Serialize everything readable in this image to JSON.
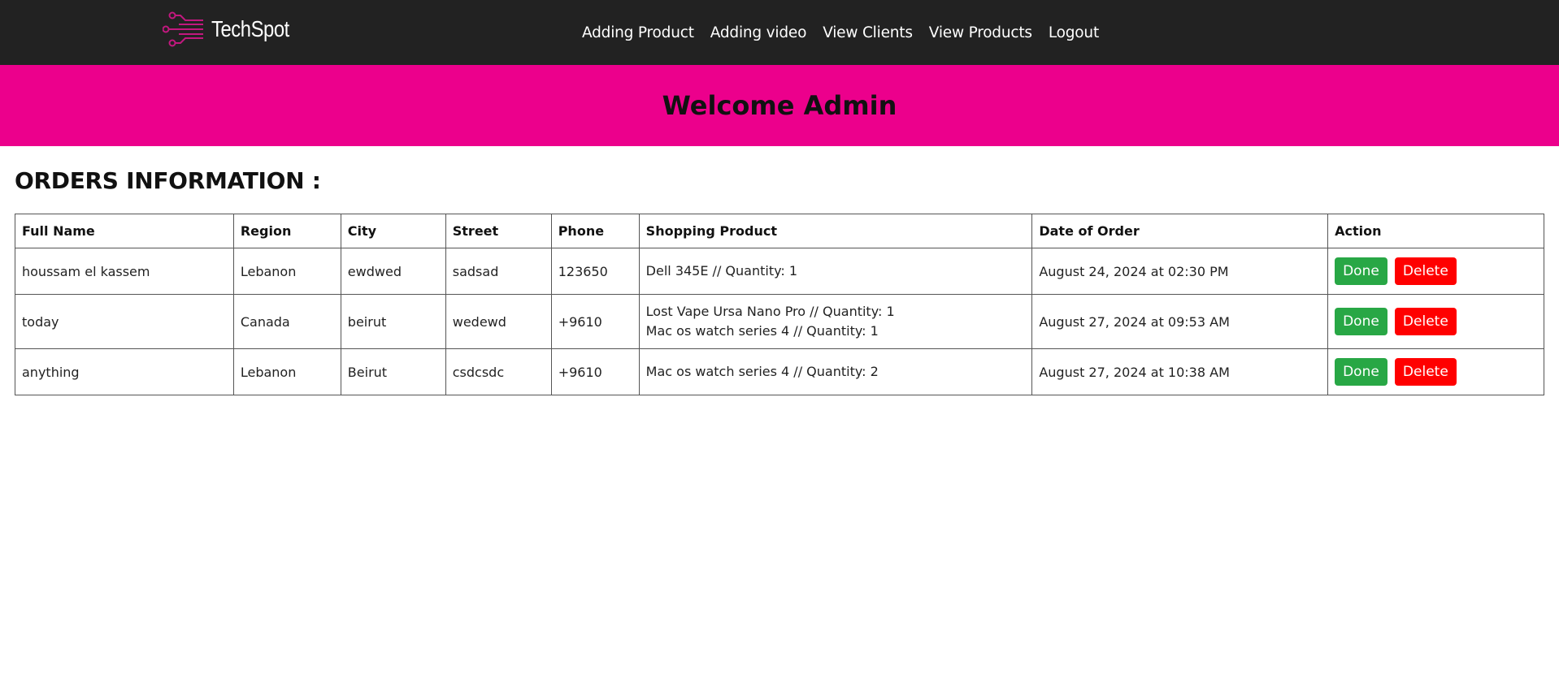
{
  "brand": {
    "name": "TechSpot",
    "logo_icon": "circuit-icon",
    "accent_color": "#ec008c"
  },
  "nav": {
    "items": [
      {
        "label": "Adding Product"
      },
      {
        "label": "Adding video"
      },
      {
        "label": "View Clients"
      },
      {
        "label": "View Products"
      },
      {
        "label": "Logout"
      }
    ]
  },
  "banner": {
    "title": "Welcome Admin",
    "background": "#ec008c"
  },
  "orders": {
    "title": "ORDERS INFORMATION :",
    "columns": [
      "Full Name",
      "Region",
      "City",
      "Street",
      "Phone",
      "Shopping Product",
      "Date of Order",
      "Action"
    ],
    "rows": [
      {
        "full_name": "houssam el kassem",
        "region": "Lebanon",
        "city": "ewdwed",
        "street": "sadsad",
        "phone": "123650",
        "products": [
          "Dell 345E // Quantity: 1"
        ],
        "date": "August 24, 2024 at 02:30 PM"
      },
      {
        "full_name": "today",
        "region": "Canada",
        "city": "beirut",
        "street": "wedewd",
        "phone": "+9610",
        "products": [
          "Lost Vape Ursa Nano Pro // Quantity: 1",
          "Mac os watch series 4 // Quantity: 1"
        ],
        "date": "August 27, 2024 at 09:53 AM"
      },
      {
        "full_name": "anything",
        "region": "Lebanon",
        "city": "Beirut",
        "street": "csdcsdc",
        "phone": "+9610",
        "products": [
          "Mac os watch series 4 // Quantity: 2"
        ],
        "date": "August 27, 2024 at 10:38 AM"
      }
    ],
    "actions": {
      "done_label": "Done",
      "delete_label": "Delete",
      "done_color": "#28a745",
      "delete_color": "#ff0000"
    }
  }
}
